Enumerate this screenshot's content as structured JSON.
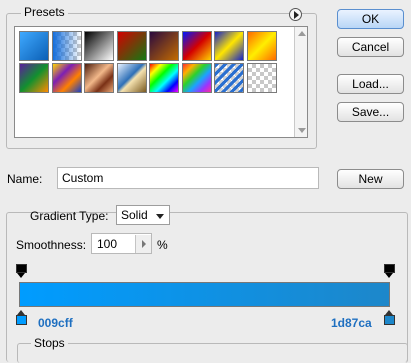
{
  "presets": {
    "title": "Presets",
    "swatches": [
      {
        "name": "foreground-to-background",
        "css": "linear-gradient(135deg, #3fa9ff 0%, #0b5fb5 100%)"
      },
      {
        "name": "foreground-to-transparent",
        "css": "linear-gradient(90deg, rgba(20,110,220,1), rgba(20,110,220,0))",
        "checker": true
      },
      {
        "name": "black-white",
        "css": "linear-gradient(135deg, #000 0%, #fff 100%)"
      },
      {
        "name": "red-green",
        "css": "linear-gradient(135deg, #d30000 0%, #127a12 100%)"
      },
      {
        "name": "violet-orange",
        "css": "linear-gradient(135deg, #2a0a3e 0%, #c26b00 100%)"
      },
      {
        "name": "blue-red-yellow",
        "css": "linear-gradient(135deg, #0016ff 0%, #d40000 50%, #ffd400 100%)"
      },
      {
        "name": "blue-yellow-blue",
        "css": "linear-gradient(135deg, #1522c9 0%, #ffe600 50%, #1522c9 100%)"
      },
      {
        "name": "orange-yellow-orange",
        "css": "linear-gradient(135deg, #ff6a00 0%, #ffee00 50%, #ff6a00 100%)"
      },
      {
        "name": "violet-green-orange",
        "css": "linear-gradient(135deg, #5b1e9c 0%, #12902f 50%, #ff8c00 100%)"
      },
      {
        "name": "yellow-violet-orange-blue",
        "css": "linear-gradient(135deg, #ffd500 0%, #7c1fb5 35%, #ff8000 65%, #1740c9 100%)"
      },
      {
        "name": "copper",
        "css": "linear-gradient(135deg, #4d1d0c 0%, #f2b88a 45%, #7a3015 70%, #e7a777 100%)"
      },
      {
        "name": "chrome",
        "css": "linear-gradient(135deg, #e6f1ff 0%, #2d6fb7 45%, #f5e2b0 55%, #7a5a20 100%)"
      },
      {
        "name": "spectrum",
        "css": "linear-gradient(135deg, #ff0000 0%, #ffff00 20%, #00ff00 40%, #00ffff 60%, #0000ff 80%, #ff00ff 100%)"
      },
      {
        "name": "transparent-rainbow",
        "css": "linear-gradient(135deg, #ff2d2d 0%, #ffb000 20%, #2cd12c 40%, #1aa3ff 60%, #9a34ff 80%, #ff2d9a 100%)",
        "checker": true
      },
      {
        "name": "transparent-stripes",
        "css": "repeating-linear-gradient(135deg, #2a6fd0 0 3px, rgba(255,255,255,0.2) 3px 6px)",
        "checker": true
      },
      {
        "name": "transparent",
        "css": "transparent",
        "checker": true
      }
    ]
  },
  "buttons": {
    "ok": "OK",
    "cancel": "Cancel",
    "load": "Load...",
    "save": "Save...",
    "new": "New"
  },
  "name_field": {
    "label": "Name:",
    "value": "Custom"
  },
  "gradient_type": {
    "label": "Gradient Type:",
    "value": "Solid"
  },
  "smoothness": {
    "label": "Smoothness:",
    "value": "100",
    "unit": "%"
  },
  "gradient": {
    "start_color": "#009cff",
    "end_color": "#1d87ca"
  },
  "stops": {
    "title": "Stops",
    "left_color_hex": "009cff",
    "right_color_hex": "1d87ca"
  }
}
